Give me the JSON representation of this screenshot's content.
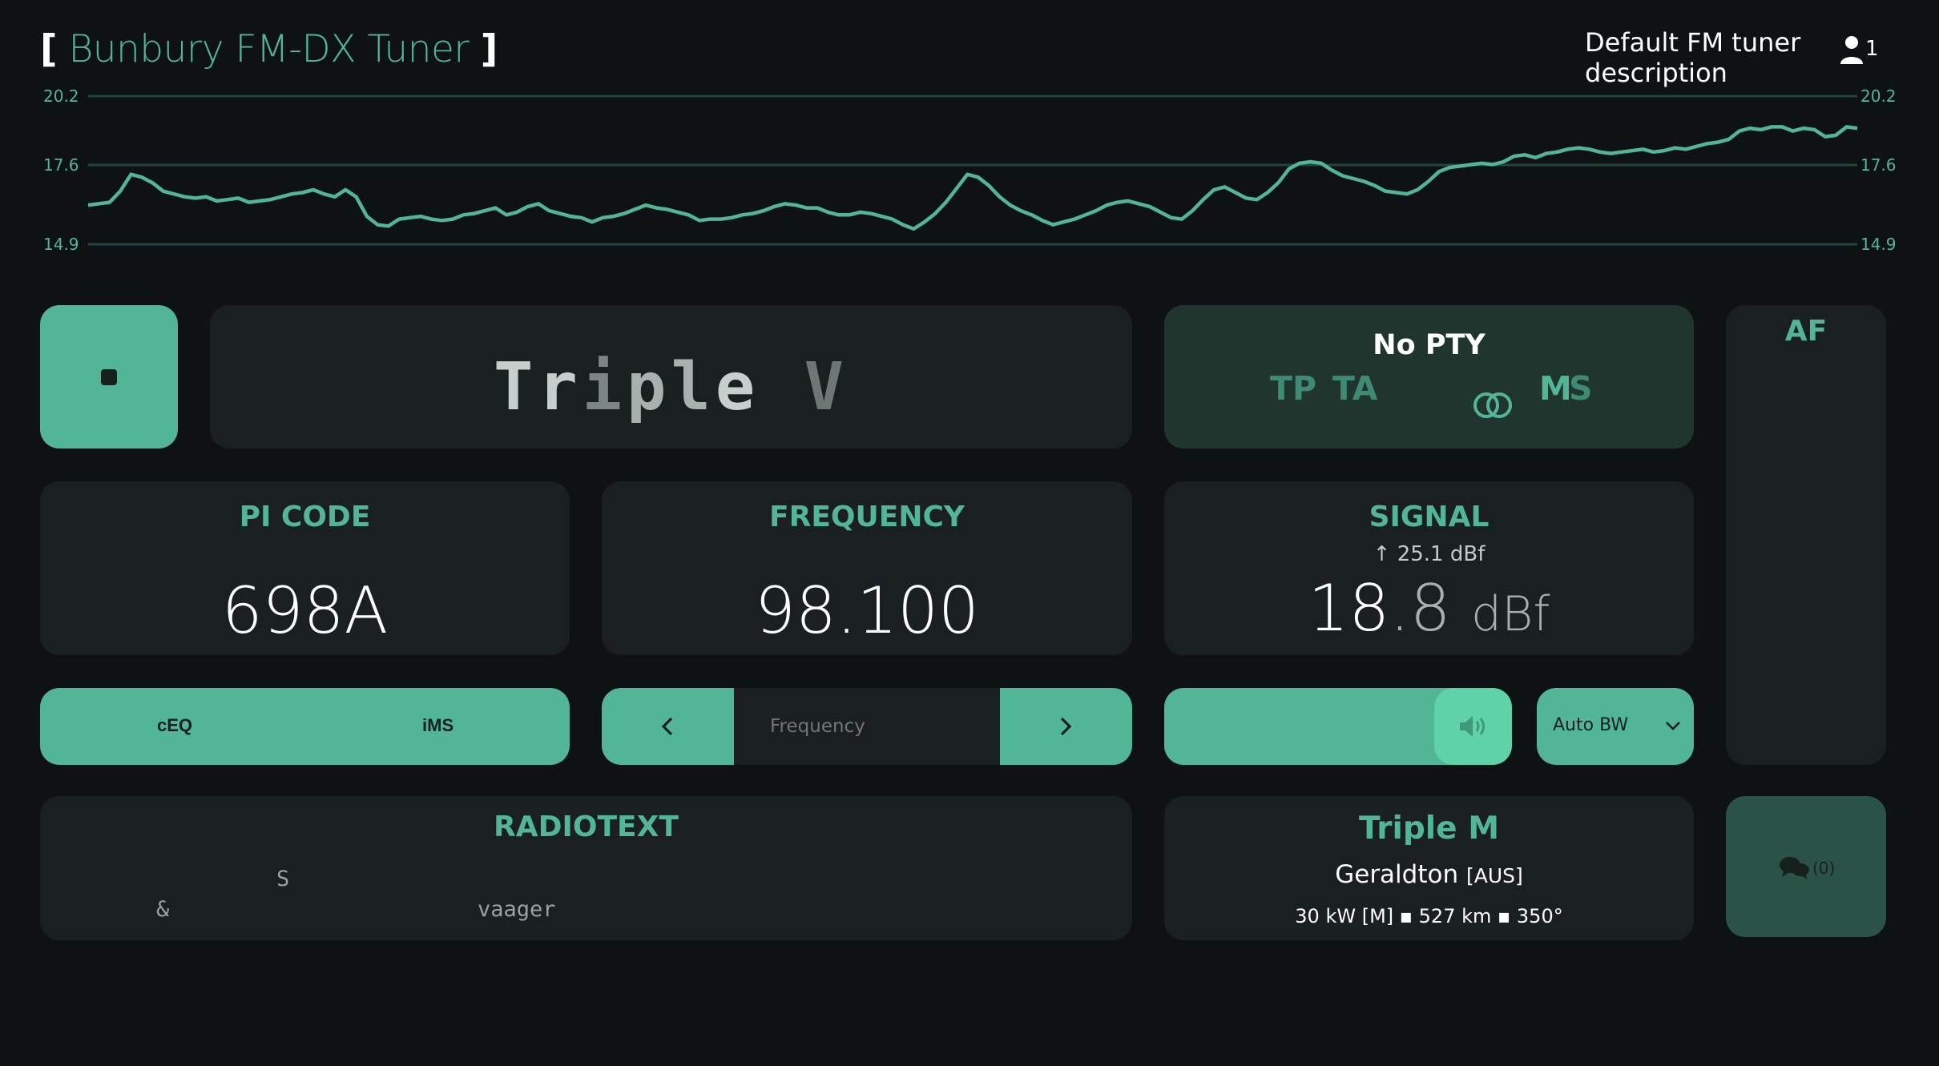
{
  "header": {
    "title": "Bunbury FM-DX Tuner",
    "bracket_open": "[",
    "bracket_close": "]",
    "description": "Default FM tuner description",
    "user_count": "1"
  },
  "signal_chart": {
    "chart_data": {
      "type": "line",
      "ylabel_ticks": [
        "20.2",
        "17.6",
        "14.9"
      ],
      "ylim": [
        14.9,
        20.2
      ],
      "grid": true,
      "values": [
        16.3,
        16.35,
        16.4,
        16.8,
        17.4,
        17.3,
        17.1,
        16.8,
        16.7,
        16.6,
        16.55,
        16.6,
        16.45,
        16.5,
        16.55,
        16.4,
        16.45,
        16.5,
        16.6,
        16.7,
        16.75,
        16.85,
        16.7,
        16.6,
        16.85,
        16.6,
        15.9,
        15.6,
        15.55,
        15.8,
        15.85,
        15.9,
        15.8,
        15.75,
        15.8,
        15.95,
        16.0,
        16.1,
        16.2,
        15.95,
        16.05,
        16.25,
        16.35,
        16.1,
        16.0,
        15.9,
        15.85,
        15.7,
        15.85,
        15.9,
        16.0,
        16.15,
        16.3,
        16.2,
        16.15,
        16.05,
        15.95,
        15.75,
        15.8,
        15.8,
        15.85,
        15.95,
        16.0,
        16.1,
        16.25,
        16.35,
        16.3,
        16.2,
        16.2,
        16.05,
        15.95,
        15.95,
        16.05,
        16.0,
        15.9,
        15.8,
        15.6,
        15.45,
        15.7,
        16.0,
        16.4,
        16.9,
        17.4,
        17.3,
        17.0,
        16.6,
        16.3,
        16.1,
        15.95,
        15.75,
        15.6,
        15.7,
        15.8,
        15.95,
        16.1,
        16.3,
        16.4,
        16.45,
        16.35,
        16.25,
        16.05,
        15.85,
        15.8,
        16.1,
        16.5,
        16.85,
        16.95,
        16.75,
        16.55,
        16.5,
        16.75,
        17.1,
        17.6,
        17.8,
        17.85,
        17.8,
        17.55,
        17.35,
        17.25,
        17.15,
        17.0,
        16.8,
        16.75,
        16.7,
        16.85,
        17.15,
        17.5,
        17.65,
        17.7,
        17.75,
        17.8,
        17.75,
        17.85,
        18.05,
        18.1,
        18.0,
        18.15,
        18.2,
        18.3,
        18.35,
        18.3,
        18.2,
        18.15,
        18.2,
        18.25,
        18.3,
        18.2,
        18.25,
        18.35,
        18.3,
        18.4,
        18.5,
        18.55,
        18.65,
        18.95,
        19.05,
        19.0,
        19.1,
        19.1,
        18.95,
        19.05,
        19.0,
        18.75,
        18.8,
        19.1,
        19.05
      ]
    }
  },
  "ps": {
    "chars": [
      "T",
      "r",
      "i",
      "p",
      "l",
      "e",
      " ",
      "V"
    ],
    "char_colors": [
      "#c7cfcc",
      "#c7cfcc",
      "#7d8684",
      "#a9b1ae",
      "#a9b1ae",
      "#c7cfcc",
      "#c7cfcc",
      "#6f7775"
    ]
  },
  "pty": {
    "label": "No PTY",
    "tp": "TP",
    "ta": "TA",
    "stereo_icon": "stereo-rings-icon",
    "ms_m": "M",
    "ms_s": "S"
  },
  "pi": {
    "label": "PI CODE",
    "value": "698A"
  },
  "frequency": {
    "label": "FREQUENCY",
    "value": "98.100"
  },
  "signal": {
    "label": "SIGNAL",
    "peak": "25.1 dBf",
    "value_int": "18",
    "value_dec": ".8",
    "unit": "dBf"
  },
  "af": {
    "label": "AF"
  },
  "controls": {
    "ceq": "cEQ",
    "ims": "iMS",
    "freq_placeholder": "Frequency",
    "prev": "‹",
    "next": "›",
    "bw_label": "Auto BW",
    "volume_level": 0.78
  },
  "radiotext": {
    "label": "RADIOTEXT",
    "line1": "S",
    "line2_a": "&",
    "line2_b": "vaager"
  },
  "tx": {
    "name": "Triple M",
    "city": "Geraldton",
    "itu": "[AUS]",
    "meta": "30 kW [M] ▪ 527 km ▪ 350°"
  },
  "chat": {
    "count": "(0)"
  },
  "colors": {
    "accent": "#52b596",
    "bg": "#0f1215",
    "panel": "#1a1f22"
  }
}
